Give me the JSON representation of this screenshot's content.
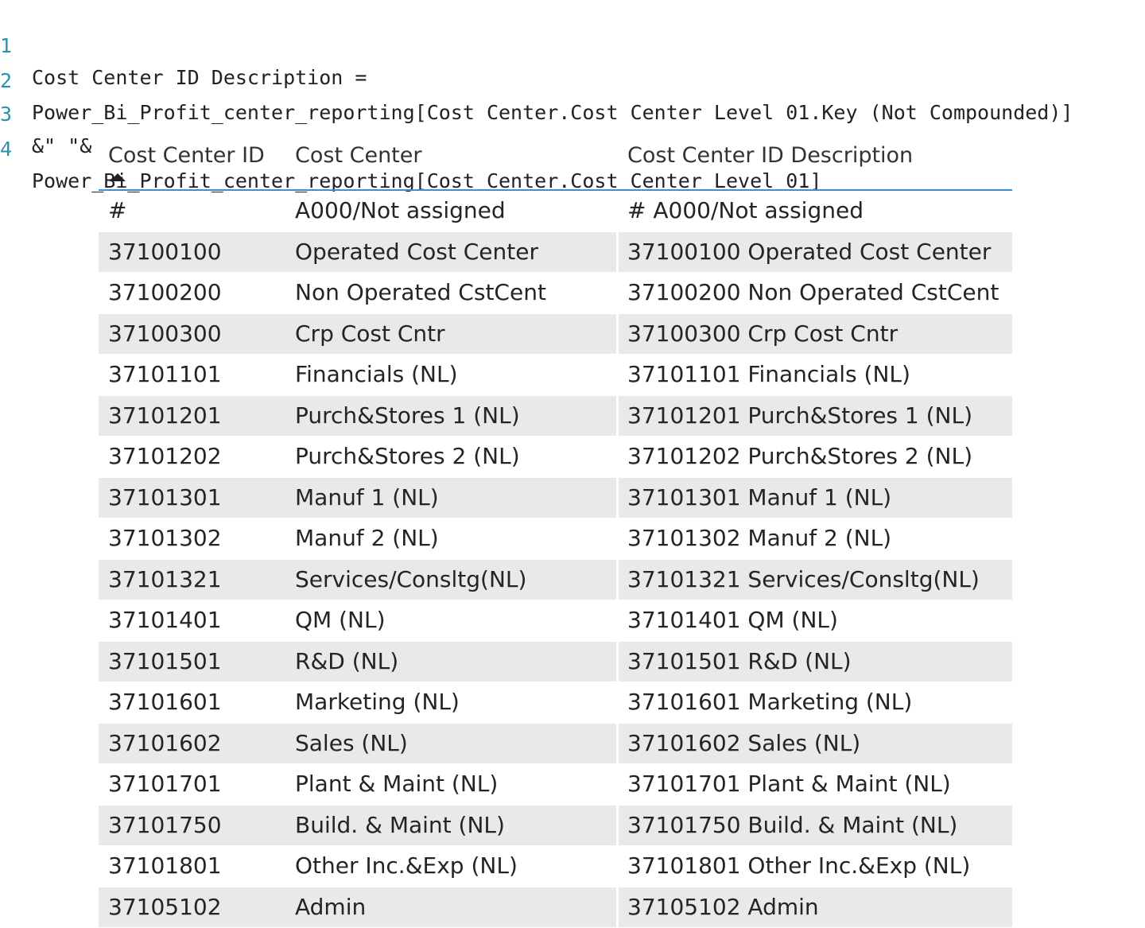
{
  "code": {
    "lines": [
      {
        "num": "1",
        "text": "Cost Center ID Description ="
      },
      {
        "num": "2",
        "text": "Power_Bi_Profit_center_reporting[Cost Center.Cost Center Level 01.Key (Not Compounded)]"
      },
      {
        "num": "3",
        "text": "&\" \"&"
      },
      {
        "num": "4",
        "text": "Power_Bi_Profit_center_reporting[Cost Center.Cost Center Level 01]"
      }
    ]
  },
  "table": {
    "headers": [
      "Cost Center ID",
      "Cost Center",
      "Cost Center ID Description"
    ],
    "sort_icon": "sort-ascending-icon",
    "rows": [
      [
        "#",
        "A000/Not assigned",
        "# A000/Not assigned"
      ],
      [
        "37100100",
        "Operated Cost Center",
        "37100100 Operated Cost Center"
      ],
      [
        "37100200",
        "Non Operated CstCent",
        "37100200 Non Operated CstCent"
      ],
      [
        "37100300",
        "Crp Cost Cntr",
        "37100300 Crp Cost Cntr"
      ],
      [
        "37101101",
        "Financials (NL)",
        "37101101 Financials (NL)"
      ],
      [
        "37101201",
        "Purch&Stores 1 (NL)",
        "37101201 Purch&Stores 1 (NL)"
      ],
      [
        "37101202",
        "Purch&Stores 2 (NL)",
        "37101202 Purch&Stores 2 (NL)"
      ],
      [
        "37101301",
        "Manuf 1 (NL)",
        "37101301 Manuf 1 (NL)"
      ],
      [
        "37101302",
        "Manuf 2 (NL)",
        "37101302 Manuf 2 (NL)"
      ],
      [
        "37101321",
        "Services/Consltg(NL)",
        "37101321 Services/Consltg(NL)"
      ],
      [
        "37101401",
        "QM (NL)",
        "37101401 QM (NL)"
      ],
      [
        "37101501",
        "R&D (NL)",
        "37101501 R&D (NL)"
      ],
      [
        "37101601",
        "Marketing (NL)",
        "37101601 Marketing (NL)"
      ],
      [
        "37101602",
        "Sales (NL)",
        "37101602 Sales (NL)"
      ],
      [
        "37101701",
        "Plant & Maint (NL)",
        "37101701 Plant & Maint (NL)"
      ],
      [
        "37101750",
        "Build. & Maint (NL)",
        "37101750 Build. & Maint (NL)"
      ],
      [
        "37101801",
        "Other Inc.&Exp (NL)",
        "37101801 Other Inc.&Exp (NL)"
      ],
      [
        "37105102",
        "Admin",
        "37105102 Admin"
      ]
    ],
    "colors": {
      "header_rule": "#3b8fd6",
      "alt_row": "#e9e9e9",
      "line_number": "#2b91af"
    }
  }
}
